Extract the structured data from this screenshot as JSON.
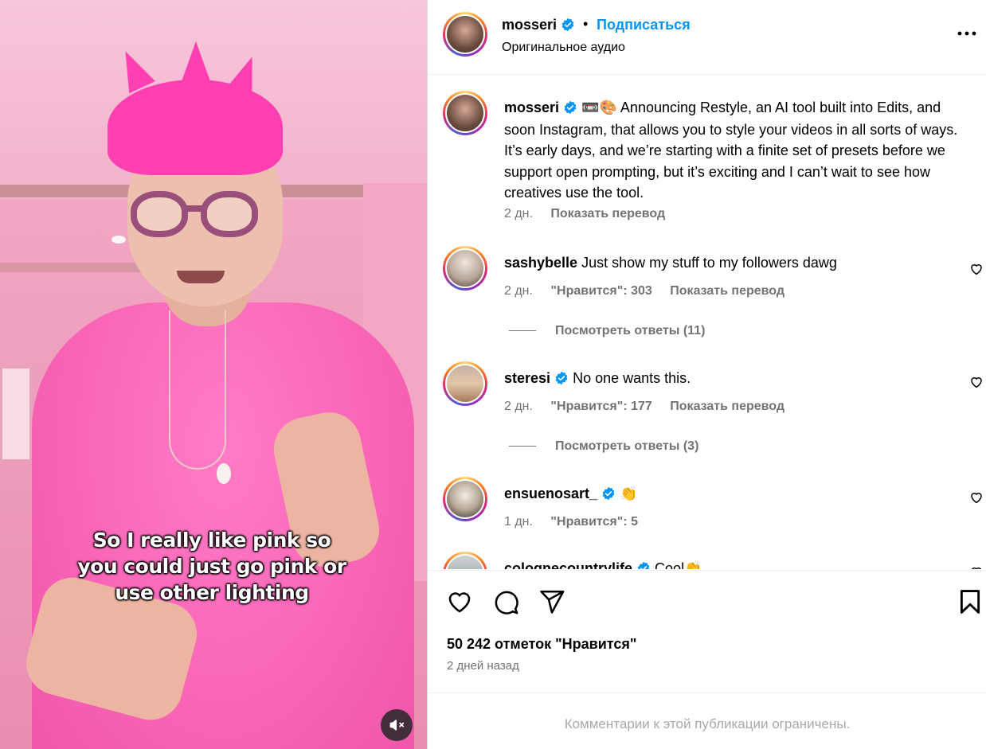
{
  "video": {
    "caption_lines": [
      "So I really like pink so",
      "you could just go pink or",
      "use other lighting"
    ],
    "mute_icon": "speaker-muted-icon"
  },
  "header": {
    "username": "mosseri",
    "separator": "•",
    "follow_label": "Подписаться",
    "audio": "Оригинальное аудио",
    "more_icon": "more-horizontal-icon"
  },
  "post": {
    "username": "mosseri",
    "emojis": "📼🎨",
    "caption": "Announcing Restyle, an AI tool built into Edits, and soon Instagram, that allows you to style your videos in all sorts of ways. It’s early days, and we’re starting with a finite set of presets before we support open prompting, but it’s exciting and I can’t wait to see how creatives use the tool.",
    "time": "2 дн.",
    "translate": "Показать перевод"
  },
  "comments": [
    {
      "username": "sashybelle",
      "verified": false,
      "text": "Just show my stuff to my followers dawg",
      "time": "2 дн.",
      "likes": "\"Нравится\": 303",
      "translate": "Показать перевод",
      "replies": "Посмотреть ответы (11)"
    },
    {
      "username": "steresi",
      "verified": true,
      "text": "No one wants this.",
      "time": "2 дн.",
      "likes": "\"Нравится\": 177",
      "translate": "Показать перевод",
      "replies": "Посмотреть ответы (3)"
    },
    {
      "username": "ensuenosart_",
      "verified": true,
      "text": "👏",
      "time": "1 дн.",
      "likes": "\"Нравится\": 5"
    },
    {
      "username": "colognecountrylife",
      "verified": true,
      "text": "Cool👏"
    }
  ],
  "actions": {
    "like_icon": "heart-icon",
    "comment_icon": "comment-icon",
    "share_icon": "send-icon",
    "save_icon": "bookmark-icon"
  },
  "stats": {
    "likes": "50 242 отметок \"Нравится\"",
    "posted": "2 дней назад"
  },
  "footer": {
    "comments_closed": "Комментарии к этой публикации ограничены."
  },
  "colors": {
    "link_blue": "#0095f6",
    "verified_blue": "#0095f6",
    "muted_text": "#737373",
    "hair_pink": "#ff3fb2"
  }
}
